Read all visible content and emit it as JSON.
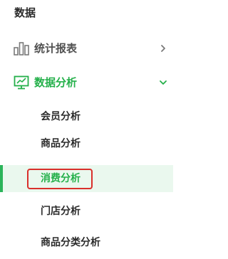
{
  "section": {
    "title": "数据"
  },
  "menus": [
    {
      "label": "统计报表",
      "icon": "bar-chart-icon",
      "arrow": "chevron-right-icon",
      "expanded": false
    },
    {
      "label": "数据分析",
      "icon": "monitor-chart-icon",
      "arrow": "chevron-down-icon",
      "expanded": true
    }
  ],
  "submenu": [
    {
      "label": "会员分析",
      "active": false
    },
    {
      "label": "商品分析",
      "active": false
    },
    {
      "label": "消费分析",
      "active": true
    },
    {
      "label": "门店分析",
      "active": false
    },
    {
      "label": "商品分类分析",
      "active": false
    }
  ],
  "colors": {
    "accent": "#24b04a",
    "active_bg": "#eaf8ee",
    "highlight_border": "#d9302b",
    "text": "#2b2b2b",
    "muted": "#505050"
  }
}
